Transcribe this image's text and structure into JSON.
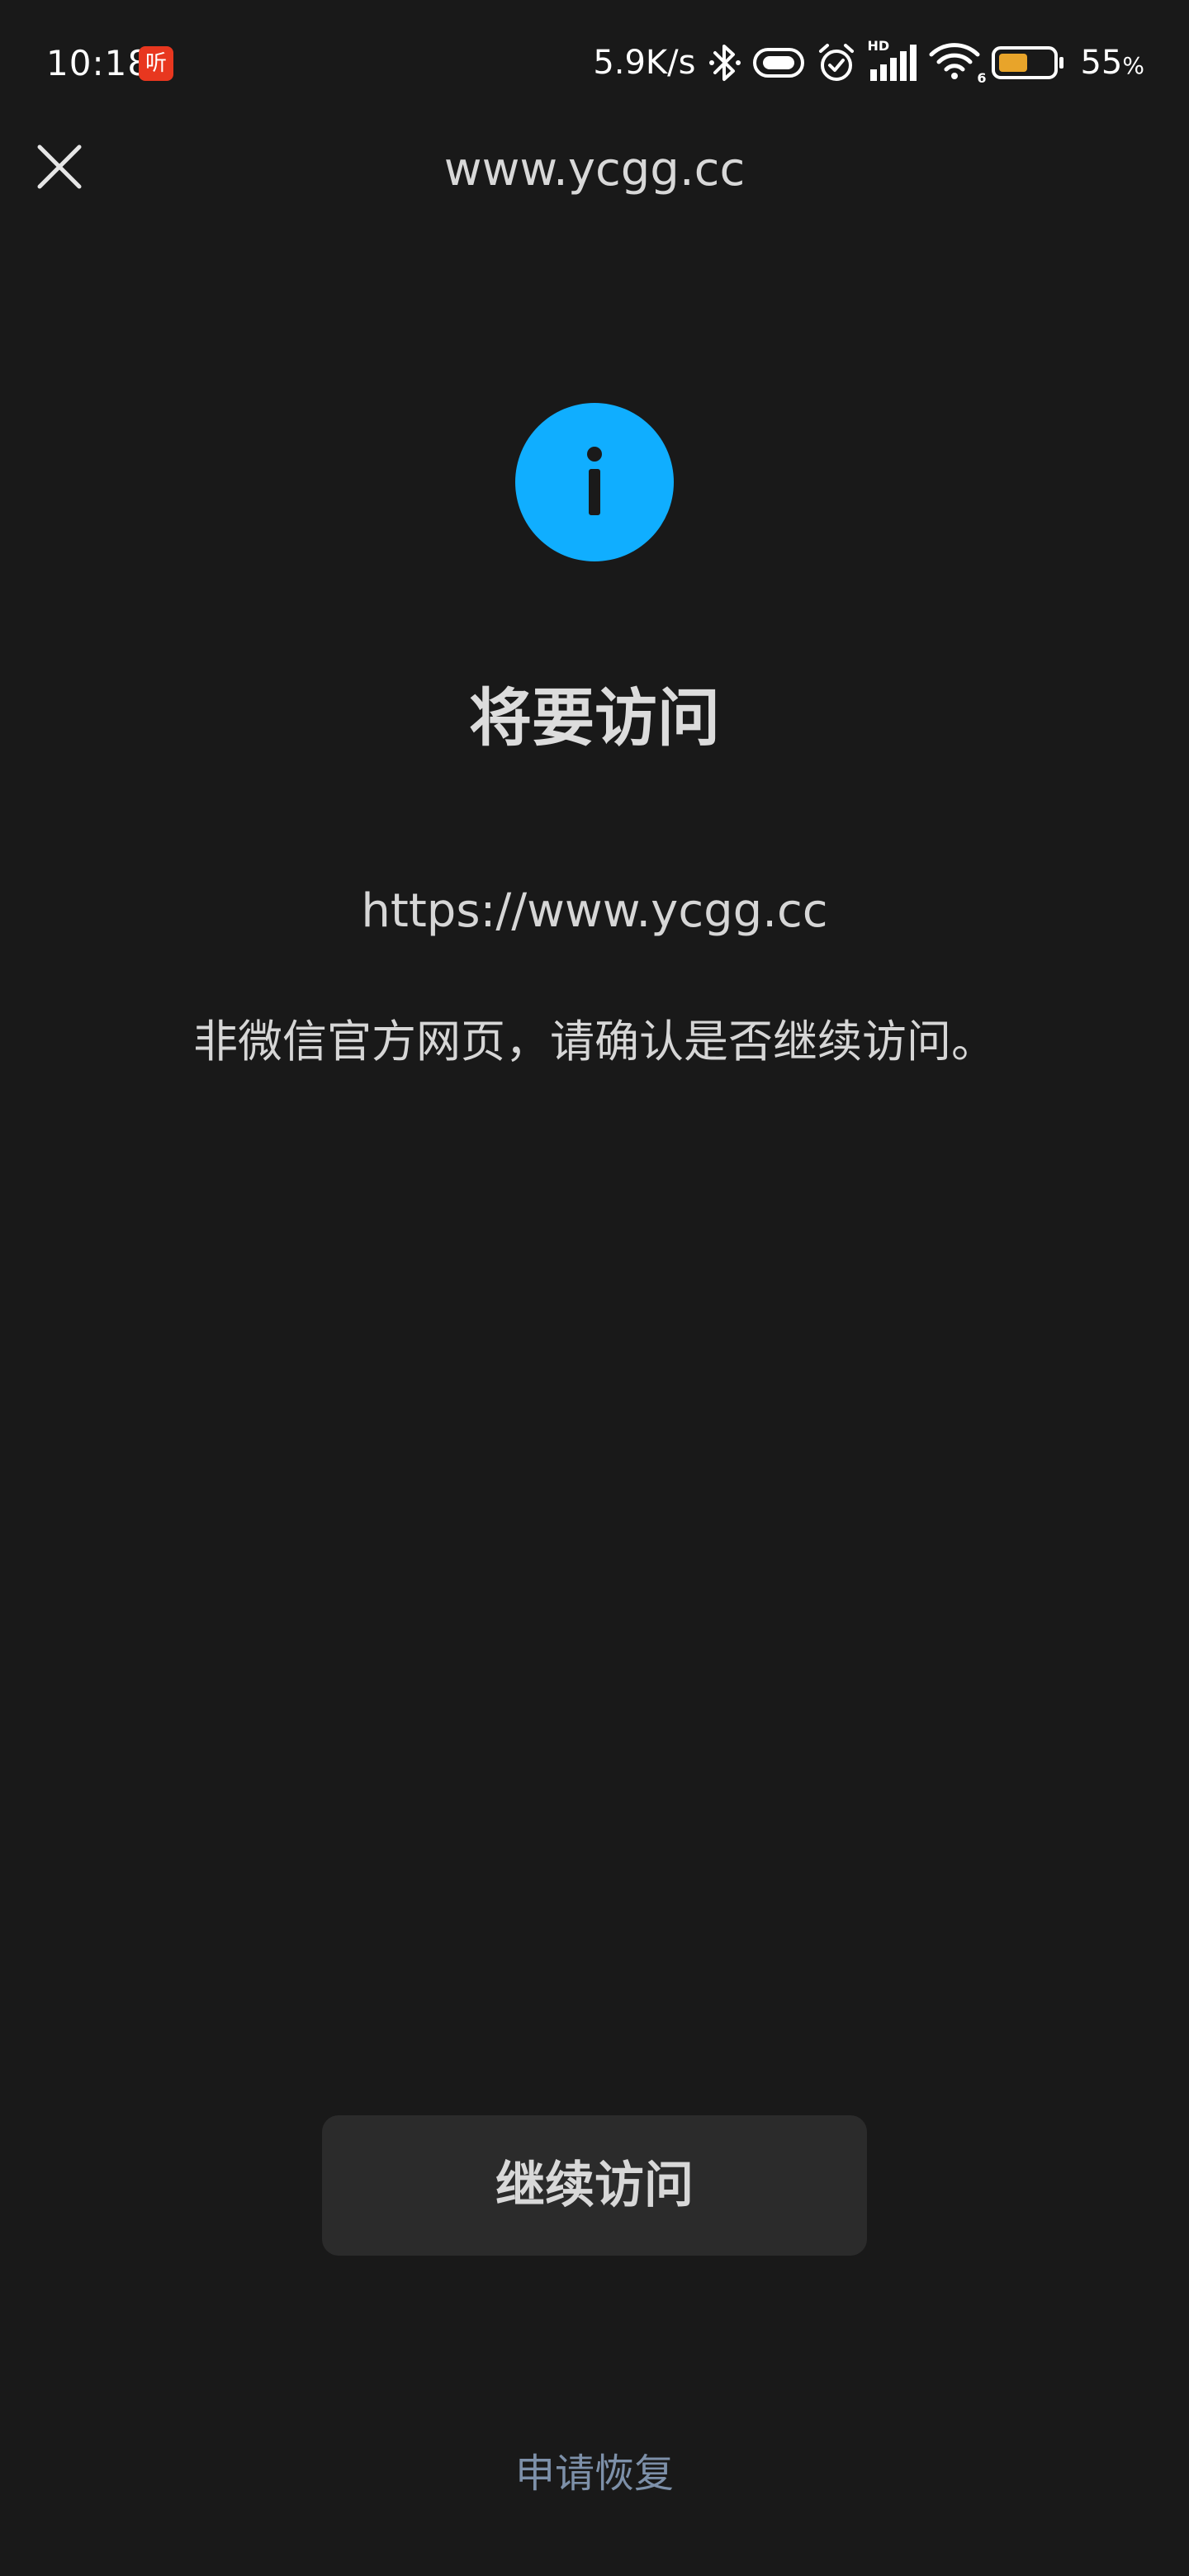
{
  "status_bar": {
    "time": "10:18",
    "app_badge": "听",
    "network_speed": "5.9K/s",
    "signal_label": "HD",
    "wifi_label": "6",
    "battery_value": "55",
    "battery_unit": "%",
    "battery_level": 0.55,
    "battery_color": "#e8a42a"
  },
  "header": {
    "domain": "www.ycgg.cc"
  },
  "content": {
    "icon": "info-icon",
    "icon_color": "#10aeff",
    "headline": "将要访问",
    "url": "https://www.ycgg.cc",
    "notice": "非微信官方网页，请确认是否继续访问。"
  },
  "actions": {
    "continue_label": "继续访问",
    "appeal_label": "申请恢复"
  }
}
